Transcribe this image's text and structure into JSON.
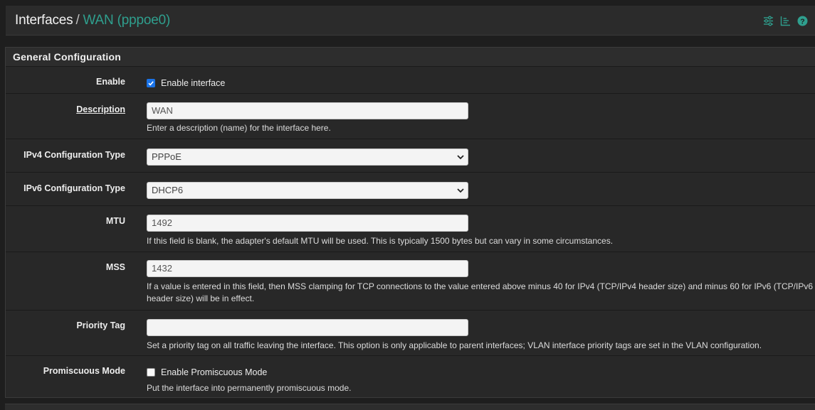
{
  "breadcrumb": {
    "section": "Interfaces",
    "separator": "/",
    "current": "WAN (pppoe0)"
  },
  "header_icons": [
    "sliders-icon",
    "chart-icon",
    "help-icon"
  ],
  "accent": "#2f9f8e",
  "panel": {
    "title": "General Configuration"
  },
  "fields": {
    "enable": {
      "label": "Enable",
      "checkbox_label": "Enable interface",
      "checked": true
    },
    "description": {
      "label": "Description",
      "value": "WAN",
      "help": "Enter a description (name) for the interface here."
    },
    "ipv4_type": {
      "label": "IPv4 Configuration Type",
      "value": "PPPoE"
    },
    "ipv6_type": {
      "label": "IPv6 Configuration Type",
      "value": "DHCP6"
    },
    "mtu": {
      "label": "MTU",
      "value": "1492",
      "help": "If this field is blank, the adapter's default MTU will be used. This is typically 1500 bytes but can vary in some circumstances."
    },
    "mss": {
      "label": "MSS",
      "value": "1432",
      "help_line1": "If a value is entered in this field, then MSS clamping for TCP connections to the value entered above minus 40 for IPv4 (TCP/IPv4 header size) and minus 60 for IPv6 (TCP/IPv6",
      "help_line2": "header size) will be in effect."
    },
    "priority_tag": {
      "label": "Priority Tag",
      "value": "",
      "help": "Set a priority tag on all traffic leaving the interface. This option is only applicable to parent interfaces; VLAN interface priority tags are set in the VLAN configuration."
    },
    "promiscuous": {
      "label": "Promiscuous Mode",
      "checkbox_label": "Enable Promiscuous Mode",
      "checked": false,
      "help": "Put the interface into permanently promiscuous mode."
    }
  }
}
